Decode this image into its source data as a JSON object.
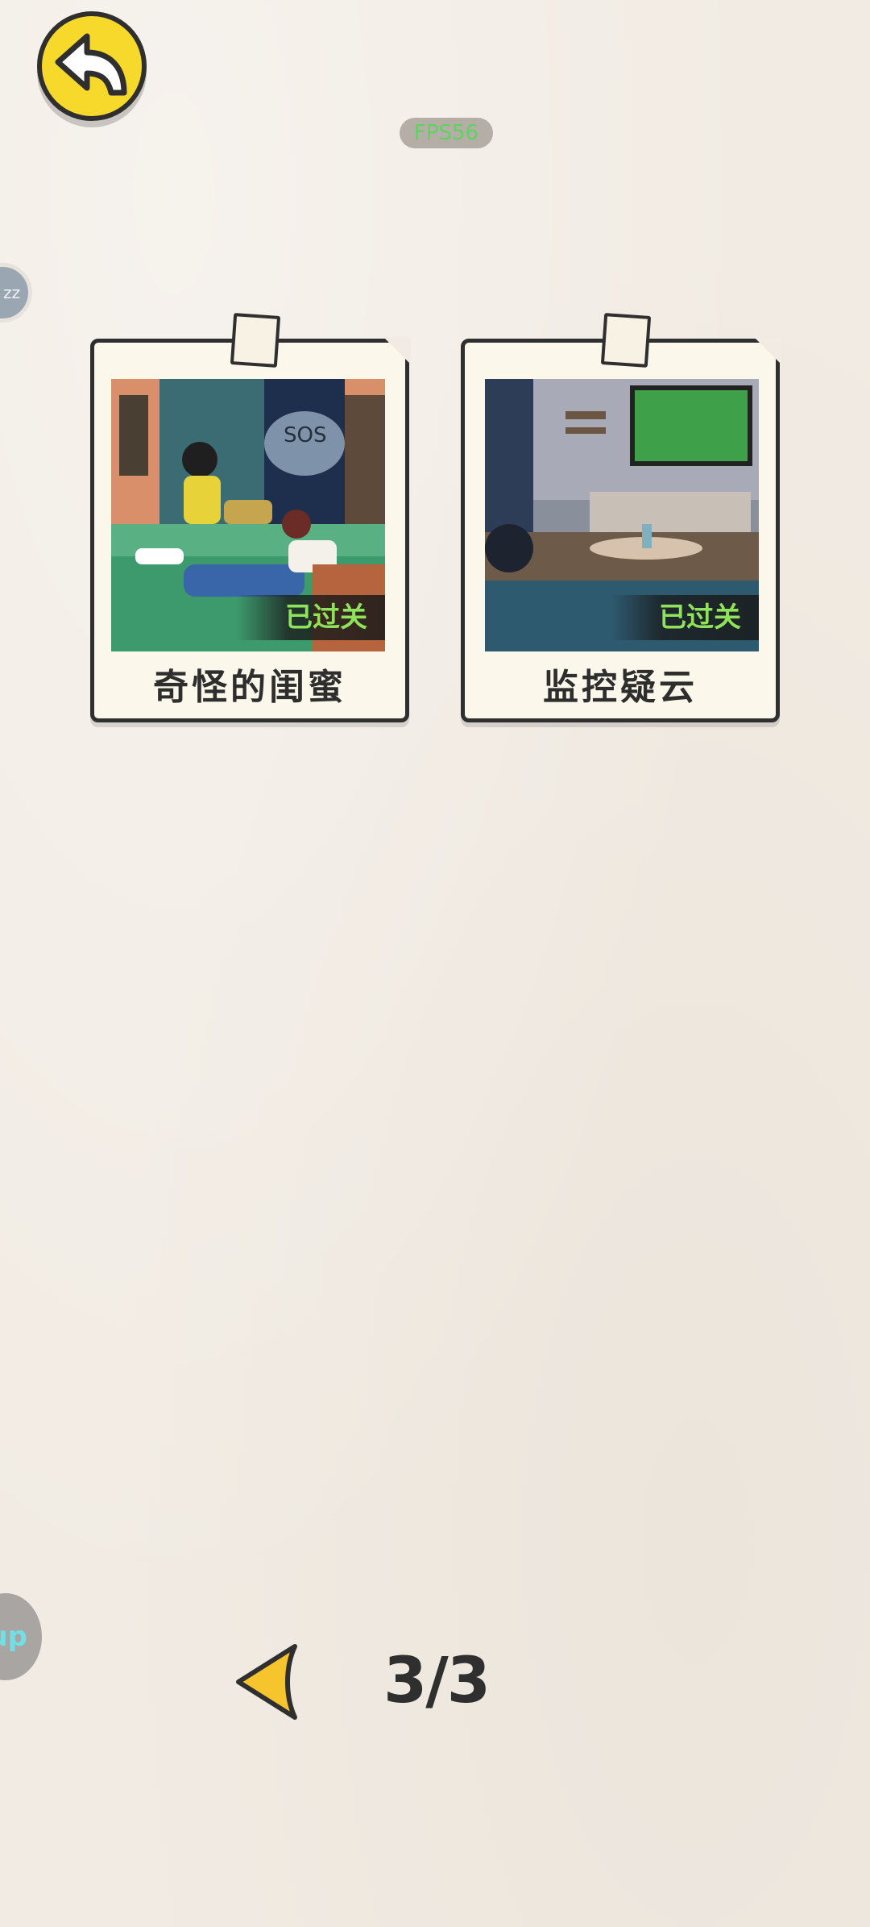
{
  "header": {
    "back_icon": "back-arrow-icon",
    "fps_label": "FPS56"
  },
  "side_buttons": {
    "top_chip_label": "zz",
    "bottom_chip_label": "up"
  },
  "levels": [
    {
      "title": "奇怪的闺蜜",
      "status": "已过关",
      "thumbnail_text": "SOS"
    },
    {
      "title": "监控疑云",
      "status": "已过关"
    }
  ],
  "pager": {
    "prev_icon": "triangle-left-icon",
    "page_indicator": "3/3"
  },
  "colors": {
    "background": "#f1ebe3",
    "accent_yellow": "#f7d92b",
    "cleared_green": "#8ee35a",
    "outline": "#2f2f2f"
  }
}
